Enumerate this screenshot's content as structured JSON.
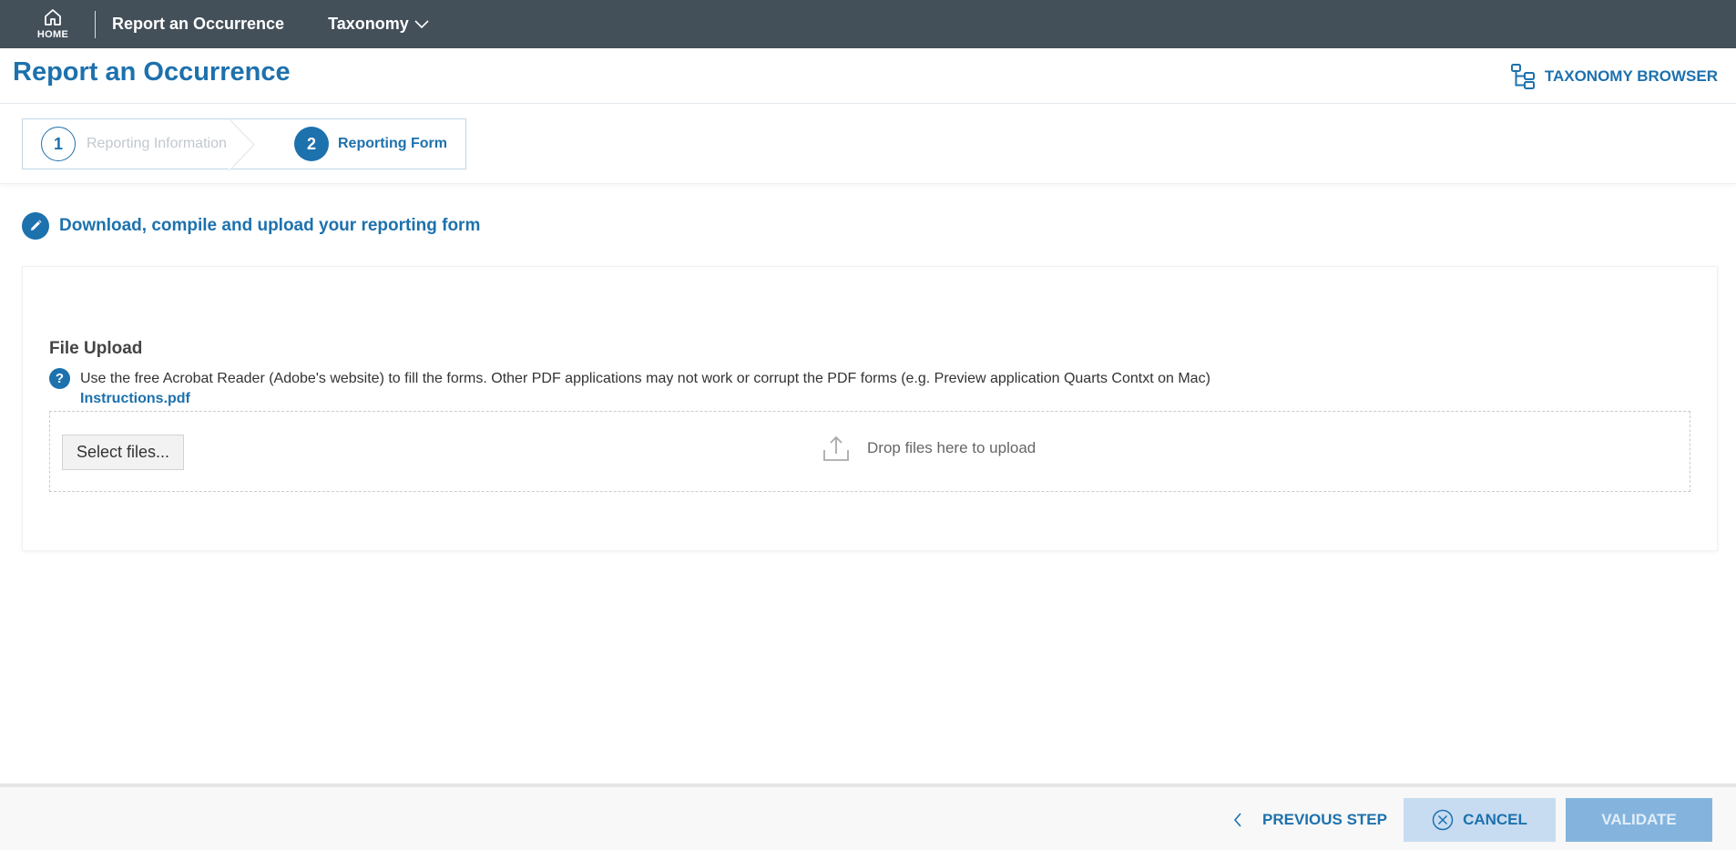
{
  "nav": {
    "home_label": "HOME",
    "items": [
      {
        "label": "Report an Occurrence"
      },
      {
        "label": "Taxonomy"
      }
    ]
  },
  "header": {
    "title": "Report an Occurrence",
    "taxonomy_browser": "TAXONOMY BROWSER"
  },
  "stepper": {
    "steps": [
      {
        "number": "1",
        "label": "Reporting Information"
      },
      {
        "number": "2",
        "label": "Reporting Form"
      }
    ]
  },
  "section": {
    "title": "Download, compile and upload your reporting form"
  },
  "upload": {
    "label": "File Upload",
    "help_text": "Use the free Acrobat Reader (Adobe's website) to fill the forms. Other PDF applications may not work or corrupt the PDF forms (e.g. Preview application Quarts Contxt on Mac)",
    "instructions_link": "Instructions.pdf",
    "select_button": "Select files...",
    "drop_hint": "Drop files here to upload"
  },
  "footer": {
    "previous": "PREVIOUS STEP",
    "cancel": "CANCEL",
    "validate": "VALIDATE"
  },
  "colors": {
    "nav_bg": "#434f59",
    "accent": "#1d71ad",
    "cancel_bg": "#c8dcf1",
    "validate_bg": "#84b4de"
  }
}
